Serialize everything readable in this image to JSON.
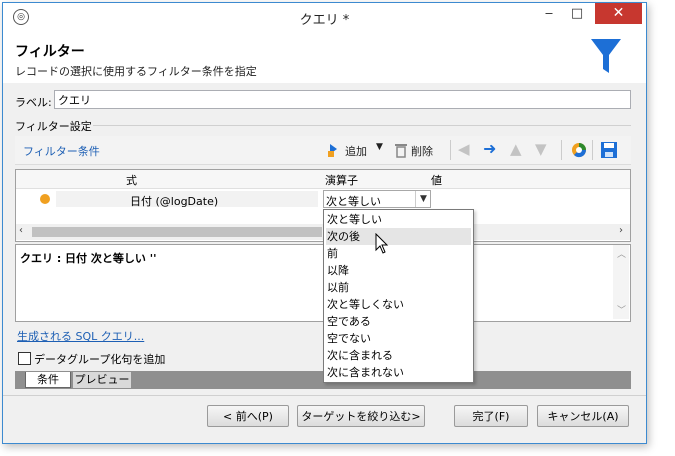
{
  "window": {
    "title": "クエリ *",
    "app_icon": "app-icon",
    "minimize": "‒",
    "maximize": "□",
    "close": "✕"
  },
  "header": {
    "title": "フィルター",
    "subtitle": "レコードの選択に使用するフィルター条件を指定",
    "icon": "funnel-icon"
  },
  "label_field": {
    "label": "ラベル:",
    "value": "クエリ"
  },
  "filter_settings": {
    "label": "フィルター設定"
  },
  "toolbar": {
    "conditions_link": "フィルター条件",
    "add_label": "追加",
    "delete_label": "削除"
  },
  "grid": {
    "columns": [
      "式",
      "演算子",
      "値"
    ],
    "row": {
      "expression": "日付 (@logDate)",
      "operator": "次と等しい"
    }
  },
  "dropdown": {
    "options": [
      "次と等しい",
      "次の後",
      "前",
      "以降",
      "以前",
      "次と等しくない",
      "空である",
      "空でない",
      "次に含まれる",
      "次に含まれない"
    ],
    "hover_index": 1
  },
  "query_text": "クエリ : 日付 次と等しい ''",
  "sql_link": "生成される SQL クエリ...",
  "checkbox": {
    "label": "データグループ化句を追加",
    "checked": false
  },
  "tabs": [
    "条件",
    "プレビュー"
  ],
  "buttons": {
    "prev": "< 前へ(P)",
    "target": "ターゲットを絞り込む>",
    "finish": "完了(F)",
    "cancel": "キャンセル(A)"
  },
  "colors": {
    "accent": "#1d6fd6",
    "link": "#1d5fb4",
    "close": "#c7372f",
    "status_dot": "#f0a020"
  }
}
